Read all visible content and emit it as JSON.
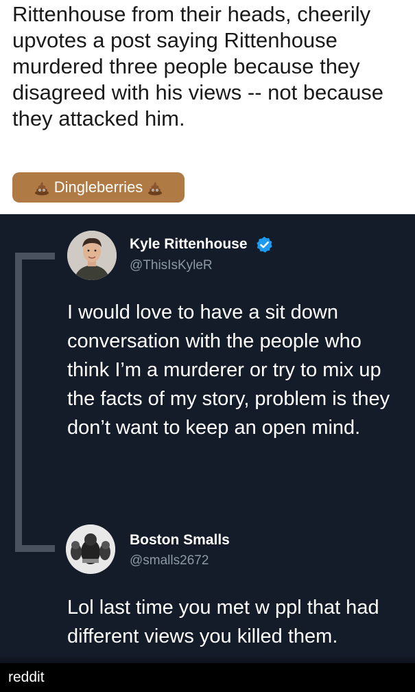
{
  "post": {
    "title": "Rittenhouse from their heads, cheerily upvotes a post saying Rittenhouse murdered three people because they disagreed with his views -- not because they attacked him.",
    "flair": {
      "label": "Dingleberries",
      "color": "#b07a45",
      "icon": "poop-emoji-icon"
    }
  },
  "tweets": [
    {
      "name": "Kyle Rittenhouse",
      "handle": "@ThisIsKyleR",
      "verified": true,
      "text": "I would love to have a sit down conversation with the people who think I’m a murderer or try to mix up the facts of my story, problem is they don’t want to keep an open mind."
    },
    {
      "name": "Boston Smalls",
      "handle": "@smalls2672",
      "verified": false,
      "text": "Lol last time you met w ppl that had different views you killed them."
    }
  ],
  "watermark": "reddit",
  "colors": {
    "tweet_background": "#151c29",
    "verified_badge": "#1d9bf0",
    "handle": "#8b98a5"
  }
}
